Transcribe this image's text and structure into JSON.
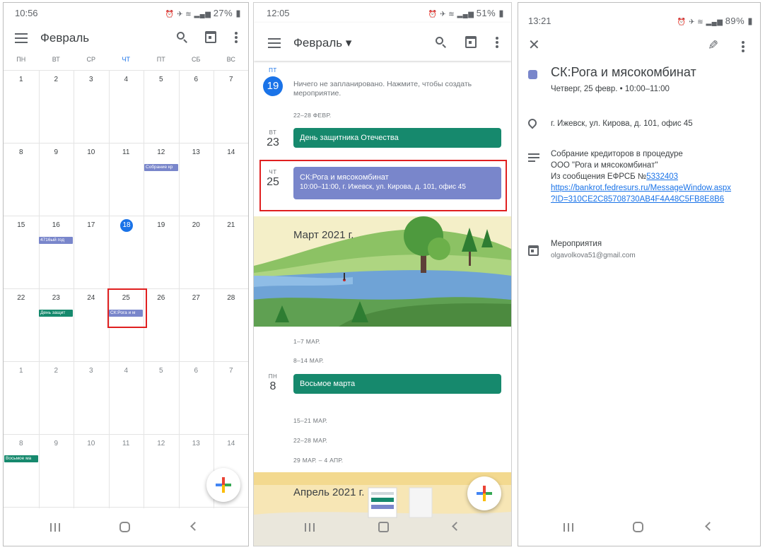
{
  "screen1": {
    "status": {
      "time": "10:56",
      "right": "27%"
    },
    "header": {
      "title": "Февраль"
    },
    "weekdays": [
      "ПН",
      "ВТ",
      "СР",
      "ЧТ",
      "ПТ",
      "СБ",
      "ВС"
    ],
    "weeks": [
      [
        "1",
        "2",
        "3",
        "4",
        "5",
        "6",
        "7"
      ],
      [
        "8",
        "9",
        "10",
        "11",
        "12",
        "13",
        "14"
      ],
      [
        "15",
        "16",
        "17",
        "18",
        "19",
        "20",
        "21"
      ],
      [
        "22",
        "23",
        "24",
        "25",
        "26",
        "27",
        "28"
      ],
      [
        "1",
        "2",
        "3",
        "4",
        "5",
        "6",
        "7"
      ],
      [
        "8",
        "9",
        "10",
        "11",
        "12",
        "13",
        "14"
      ]
    ],
    "events": {
      "feb12": "Собрание кр",
      "feb16": "4716ый год",
      "feb23": "День защит",
      "feb25": "СК:Рога и м",
      "mar8": "Восьмое ма"
    }
  },
  "screen2": {
    "status": {
      "time": "12:05",
      "right": "51%"
    },
    "header": {
      "title": "Февраль ▾"
    },
    "day19": {
      "dow": "ПТ",
      "num": "19",
      "empty_text": "Ничего не запланировано. Нажмите, чтобы создать мероприятие."
    },
    "weeks": {
      "w1": "22–28 ФЕВР.",
      "w2": "1–7 МАР.",
      "w3": "8–14 МАР.",
      "w4": "15–21 МАР.",
      "w5": "22–28 МАР.",
      "w6": "29 МАР. – 4 АПР."
    },
    "day23": {
      "dow": "ВТ",
      "num": "23",
      "event": "День защитника Отечества"
    },
    "day25": {
      "dow": "ЧТ",
      "num": "25",
      "event_title": "СК:Рога и мясокомбинат",
      "event_sub": "10:00–11:00, г. Ижевск, ул. Кирова, д. 101, офис 45"
    },
    "march_banner": "Март 2021 г.",
    "day8": {
      "dow": "ПН",
      "num": "8",
      "event": "Восьмое марта"
    },
    "april_banner": "Апрель 2021 г."
  },
  "screen3": {
    "status": {
      "time": "13:21",
      "right": "89%"
    },
    "event": {
      "title": "СК:Рога и мясокомбинат",
      "when": "Четверг, 25 февр. • 10:00–11:00",
      "location": "г. Ижевск, ул. Кирова, д. 101, офис 45",
      "desc_line1": "Собрание кредиторов в процедуре",
      "desc_line2": "ООО \"Рога и мясокомбинат\"",
      "desc_line3": "Из сообщения ЕФРСБ №",
      "desc_number": "5332403",
      "url_line1": "https://bankrot.fedresurs.ru/MessageWindow.aspx",
      "url_line2": "?ID=310CE2C85708730AB4F4A48C5FB8E8B6",
      "calendar_name": "Мероприятия",
      "calendar_account": "olgavolkova51@gmail.com"
    }
  },
  "colors": {
    "accent": "#1a73e8",
    "lavender": "#7986cb",
    "teal": "#16896d",
    "highlight": "#e02020"
  }
}
